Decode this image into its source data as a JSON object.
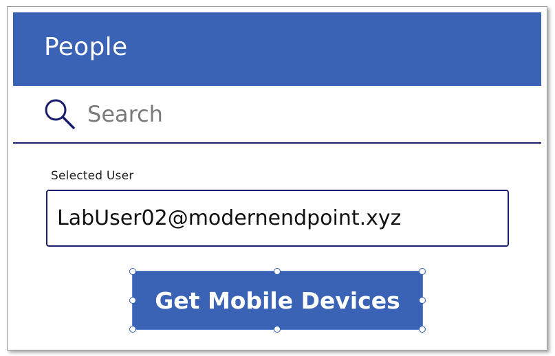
{
  "header": {
    "title": "People"
  },
  "search": {
    "placeholder": "Search",
    "icon": "search-icon"
  },
  "selected_user": {
    "label": "Selected User",
    "value": "LabUser02@modernendpoint.xyz"
  },
  "action": {
    "label": "Get Mobile Devices",
    "selected": true
  },
  "colors": {
    "header_bg": "#3a62b5",
    "button_bg": "#3a62b5",
    "border_navy": "#1a1c6e",
    "text_white": "#ffffff"
  }
}
